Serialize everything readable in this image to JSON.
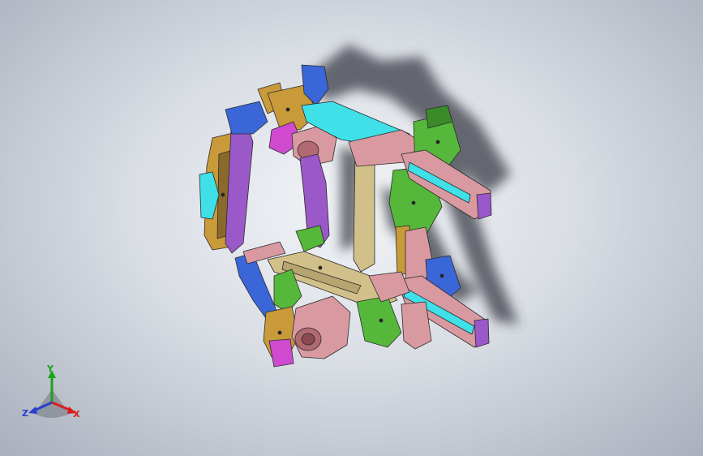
{
  "viewport": {
    "background_center": "#f2f4f7",
    "background_edge": "#a9b0bc"
  },
  "model": {
    "icon": "vehicle-subframe-assembly",
    "part_colors": {
      "orange": "#c89a3a",
      "purple": "#9a58c8",
      "magenta": "#d04ad0",
      "cyan": "#3fe0e8",
      "green": "#55b83a",
      "pink": "#d89aa0",
      "blue": "#3a66d8",
      "tan": "#d2c08a",
      "shadow": "#3a3e46"
    }
  },
  "triad": {
    "y_label": "Y",
    "z_label": "Z",
    "x_label": "X",
    "y_color": "#19a319",
    "z_color": "#2a3fd0",
    "x_color": "#d81e1e"
  }
}
